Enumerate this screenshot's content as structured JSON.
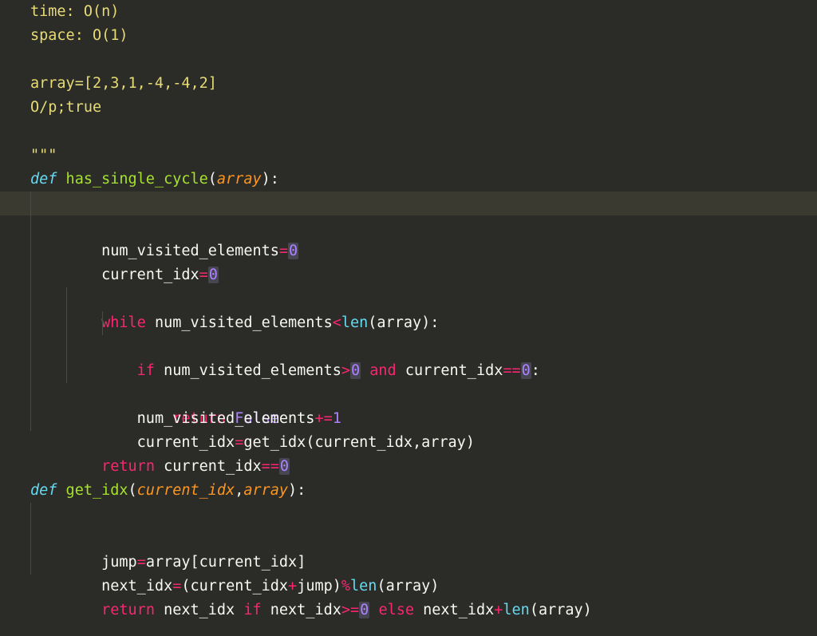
{
  "docstring": {
    "l1": "time: O(n)",
    "l2": "space: O(1)",
    "l3": "array=[2,3,1,-4,-4,2]",
    "l4": "O/p;true",
    "l5": "\"\"\""
  },
  "fn1": {
    "def": "def",
    "name": " has_single_cycle",
    "open": "(",
    "param": "array",
    "close": "):",
    "line2": {
      "var": "    num_visited_elements",
      "eq": "=",
      "num": "0"
    },
    "line3": {
      "var": "    current_idx",
      "eq": "=",
      "num": "0"
    },
    "while": {
      "kw": "    while",
      "sp": " ",
      "var1": "num_visited_elements",
      "lt": "<",
      "len": "len",
      "open": "(",
      "arr": "array",
      "close": "):"
    },
    "if": {
      "pre": "        ",
      "kw": "if",
      "sp": " ",
      "var1": "num_visited_elements",
      "gt": ">",
      "num0": "0",
      "sp2": " ",
      "and": "and",
      "sp3": " ",
      "var2": "current_idx",
      "eq": "==",
      "num0b": "0",
      "colon": ":"
    },
    "ret_false": {
      "pre": "            ",
      "kw": "return",
      "sp": " ",
      "val": "False"
    },
    "inc": {
      "pre": "        ",
      "var": "num_visited_elements",
      "op": "+=",
      "num": "1"
    },
    "assign": {
      "pre": "        ",
      "var": "current_idx",
      "eq": "=",
      "fn": "get_idx",
      "open": "(",
      "arg1": "current_idx",
      "comma": ",",
      "arg2": "array",
      "close": ")"
    },
    "ret": {
      "pre": "    ",
      "kw": "return",
      "sp": " ",
      "var": "current_idx",
      "eq": "==",
      "num": "0"
    }
  },
  "fn2": {
    "def": "def",
    "name": " get_idx",
    "open": "(",
    "p1": "current_idx",
    "comma": ",",
    "p2": "array",
    "close": "):",
    "l1": {
      "pre": "    ",
      "var": "jump",
      "eq": "=",
      "arr": "array",
      "ob": "[",
      "idx": "current_idx",
      "cb": "]"
    },
    "l2": {
      "pre": "    ",
      "var": "next_idx",
      "eq": "=",
      "op1": "(",
      "a": "current_idx",
      "plus": "+",
      "b": "jump",
      "cp": ")",
      "mod": "%",
      "len": "len",
      "op2": "(",
      "arr": "array",
      "cp2": ")"
    },
    "l3": {
      "pre": "    ",
      "kw": "return",
      "sp": " ",
      "var": "next_idx",
      "sp2": " ",
      "if": "if",
      "sp3": " ",
      "var2": "next_idx",
      "ge": ">=",
      "num": "0",
      "sp4": " ",
      "else": "else",
      "sp5": " ",
      "var3": "next_idx",
      "plus": "+",
      "len": "len",
      "op": "(",
      "arr": "array",
      "cp": ")"
    }
  }
}
